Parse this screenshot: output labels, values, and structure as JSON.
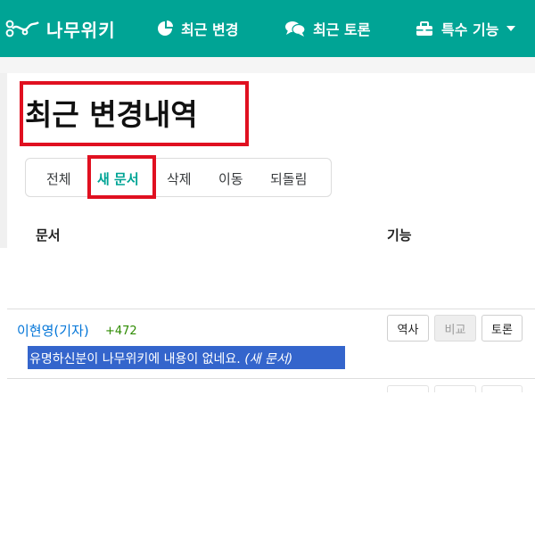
{
  "header": {
    "brand": "나무위키",
    "nav": [
      {
        "label": "최근 변경",
        "icon": "pie-chart-icon"
      },
      {
        "label": "최근 토론",
        "icon": "comments-icon"
      },
      {
        "label": "특수 기능",
        "icon": "toolbox-icon"
      }
    ],
    "colors": {
      "brand": "#00a495",
      "highlight_box": "#e01020",
      "selection": "#3465cc"
    }
  },
  "page": {
    "title": "최근 변경내역",
    "tabs": [
      {
        "label": "전체"
      },
      {
        "label": "새 문서",
        "active": true
      },
      {
        "label": "삭제"
      },
      {
        "label": "이동"
      },
      {
        "label": "되돌림"
      }
    ],
    "columns": {
      "document": "문서",
      "actions": "기능"
    }
  },
  "changes": [
    {
      "document": "이현영(기자)",
      "delta": "+472",
      "summary": "유명하신분이 나무위키에 내용이 없네요.",
      "summary_tag": "(새 문서)",
      "actions": [
        {
          "label": "역사",
          "disabled": false
        },
        {
          "label": "비교",
          "disabled": true
        },
        {
          "label": "토론",
          "disabled": false
        }
      ]
    }
  ]
}
